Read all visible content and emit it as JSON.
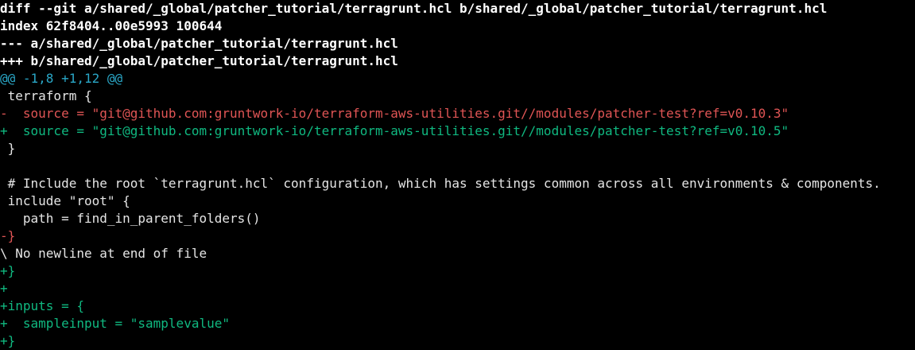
{
  "terminal": {
    "lines": [
      {
        "kind": "meta",
        "text": "diff --git a/shared/_global/patcher_tutorial/terragrunt.hcl b/shared/_global/patcher_tutorial/terragrunt.hcl"
      },
      {
        "kind": "meta",
        "text": "index 62f8404..00e5993 100644"
      },
      {
        "kind": "meta",
        "text": "--- a/shared/_global/patcher_tutorial/terragrunt.hcl"
      },
      {
        "kind": "meta",
        "text": "+++ b/shared/_global/patcher_tutorial/terragrunt.hcl"
      },
      {
        "kind": "hunk",
        "text": "@@ -1,8 +1,12 @@"
      },
      {
        "kind": "ctx",
        "text": " terraform {"
      },
      {
        "kind": "del",
        "text": "-  source = \"git@github.com:gruntwork-io/terraform-aws-utilities.git//modules/patcher-test?ref=v0.10.3\""
      },
      {
        "kind": "add",
        "text": "+  source = \"git@github.com:gruntwork-io/terraform-aws-utilities.git//modules/patcher-test?ref=v0.10.5\""
      },
      {
        "kind": "ctx",
        "text": " }"
      },
      {
        "kind": "ctx",
        "text": " "
      },
      {
        "kind": "ctx",
        "text": " # Include the root `terragrunt.hcl` configuration, which has settings common across all environments & components."
      },
      {
        "kind": "ctx",
        "text": " include \"root\" {"
      },
      {
        "kind": "ctx",
        "text": "   path = find_in_parent_folders()"
      },
      {
        "kind": "del",
        "text": "-}"
      },
      {
        "kind": "note",
        "text": "\\ No newline at end of file"
      },
      {
        "kind": "add",
        "text": "+}"
      },
      {
        "kind": "add",
        "text": "+"
      },
      {
        "kind": "add",
        "text": "+inputs = {"
      },
      {
        "kind": "add",
        "text": "+  sampleinput = \"samplevalue\""
      },
      {
        "kind": "add",
        "text": "+}"
      }
    ]
  },
  "colors": {
    "background": "#000000",
    "meta": "#ffffff",
    "hunk": "#2aa7c7",
    "context": "#e5e5e5",
    "deletion": "#e05555",
    "addition": "#10b981"
  }
}
